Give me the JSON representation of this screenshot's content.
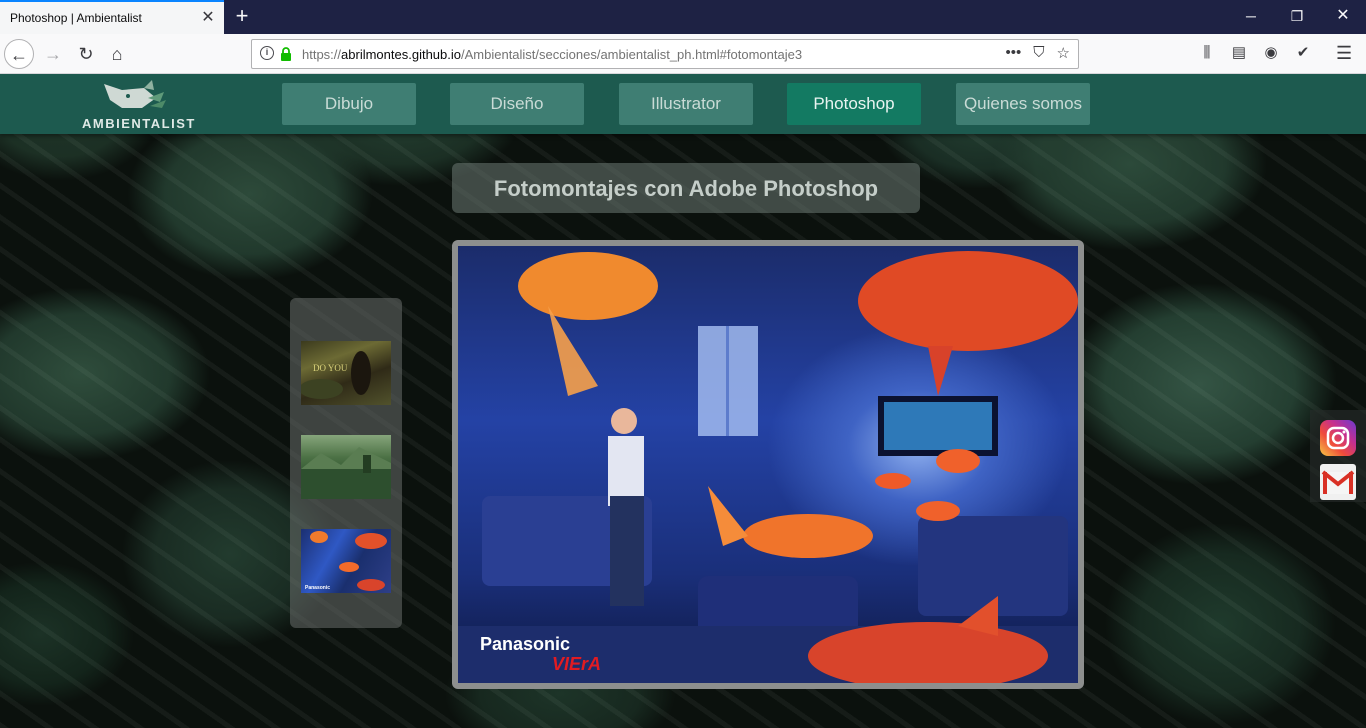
{
  "browser": {
    "tab_title": "Photoshop | Ambientalist",
    "url_host": "abrilmontes.github.io",
    "url_prefix": "https://",
    "url_path": "/Ambientalist/secciones/ambientalist_ph.html#fotomontaje3"
  },
  "site": {
    "logo_text": "AMBIENTALIST",
    "nav": [
      {
        "label": "Dibujo",
        "active": false
      },
      {
        "label": "Diseño",
        "active": false
      },
      {
        "label": "Illustrator",
        "active": false
      },
      {
        "label": "Photoshop",
        "active": true
      },
      {
        "label": "Quienes somos",
        "active": false
      }
    ],
    "page_title": "Fotomontajes con Adobe Photoshop",
    "thumbnails": [
      {
        "caption": "DO YOU"
      },
      {
        "caption": ""
      },
      {
        "caption": "Panasonic"
      }
    ],
    "main_image_brand": "Panasonic",
    "main_image_sub": "VIErA",
    "social": [
      "instagram-icon",
      "gmail-icon"
    ]
  },
  "colors": {
    "header": "#1d5a4f",
    "nav_item": "#3f7e73",
    "nav_active": "#137a62"
  }
}
